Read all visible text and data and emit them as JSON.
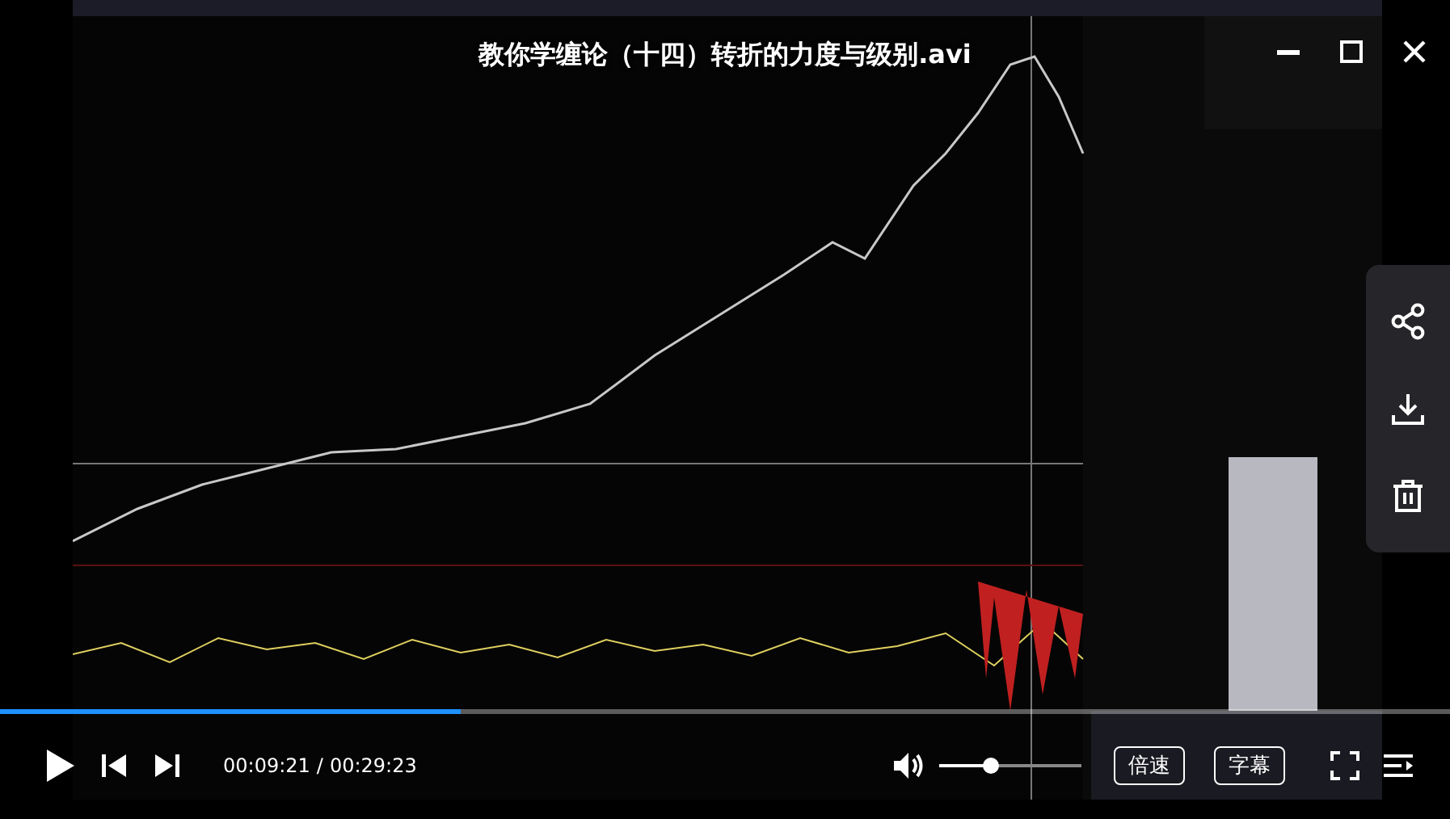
{
  "video": {
    "kind": "picture",
    "title": "教你学缠论（十四）转折的力度与级别.avi"
  },
  "window_controls": [
    {
      "kind": "minimize"
    },
    {
      "kind": "maximize"
    },
    {
      "kind": "close"
    }
  ],
  "side_panel": [
    {
      "kind": "share"
    },
    {
      "kind": "download"
    },
    {
      "kind": "delete"
    }
  ],
  "progress": {
    "level": 0.318
  },
  "controls": {
    "playing": false,
    "current_time": "00:09:21",
    "separator": "/",
    "total_time": "00:29:23",
    "volume": {
      "muted": false,
      "level": 0.36
    },
    "buttons": [
      "倍速",
      "字幕"
    ]
  }
}
